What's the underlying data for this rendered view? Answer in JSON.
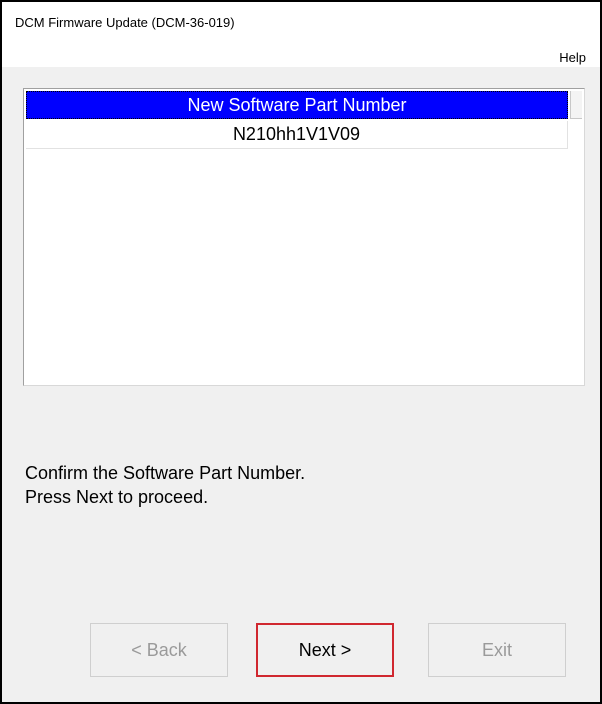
{
  "window": {
    "title": "DCM Firmware Update (DCM-36-019)"
  },
  "menu": {
    "help_label": "Help"
  },
  "list": {
    "header": "New Software Part Number",
    "rows": [
      "N210hh1V1V09"
    ],
    "header_color": "#0000ff"
  },
  "instructions": {
    "line1": "Confirm the Software Part Number.",
    "line2": "Press Next to proceed."
  },
  "buttons": {
    "back_label": "< Back",
    "next_label": "Next >",
    "exit_label": "Exit",
    "highlight_color": "#d0272f"
  }
}
